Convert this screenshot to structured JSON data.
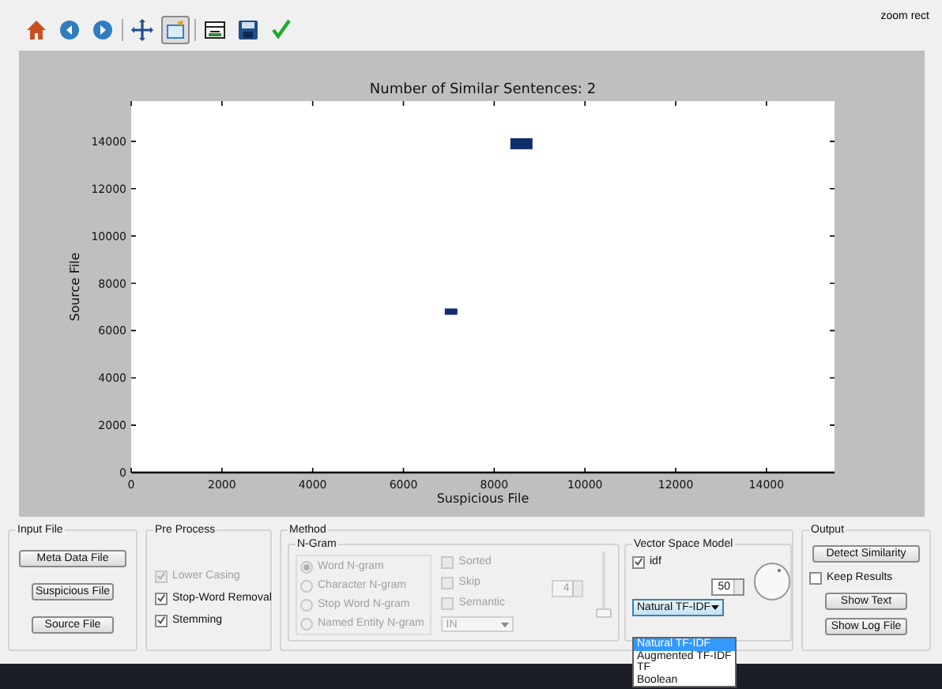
{
  "toolbar": {
    "tools": [
      {
        "kind": "home",
        "selected": false
      },
      {
        "kind": "back",
        "selected": false
      },
      {
        "kind": "forward",
        "selected": false
      },
      {
        "kind": "pan",
        "selected": false
      },
      {
        "kind": "zoom",
        "selected": true
      },
      {
        "kind": "subplots",
        "selected": false
      },
      {
        "kind": "save",
        "selected": false
      },
      {
        "kind": "check",
        "selected": false
      }
    ],
    "mode_label": "zoom rect"
  },
  "plot": {
    "chart_data": {
      "type": "scatter",
      "title": "Number of Similar Sentences: 2",
      "xlabel": "Suspicious File",
      "ylabel": "Source File",
      "x": [
        8600,
        7050
      ],
      "values": [
        13900,
        6800
      ],
      "xlim": [
        0,
        15500
      ],
      "ylim": [
        0,
        15700
      ],
      "xticks": [
        0,
        2000,
        4000,
        6000,
        8000,
        10000,
        12000,
        14000
      ],
      "yticks": [
        0,
        2000,
        4000,
        6000,
        8000,
        10000,
        12000,
        14000
      ]
    }
  },
  "input_file": {
    "title": "Input File",
    "buttons": [
      "Meta Data File",
      "Suspicious File",
      "Source File"
    ]
  },
  "pre_process": {
    "title": "Pre Process",
    "options": [
      {
        "label": "Lower Casing",
        "checked": true,
        "disabled": true
      },
      {
        "label": "Stop-Word Removal",
        "checked": true,
        "disabled": false
      },
      {
        "label": "Stemming",
        "checked": true,
        "disabled": false
      }
    ]
  },
  "method": {
    "title": "Method",
    "n_gram": {
      "title": "N-Gram",
      "radios": [
        {
          "label": "Word N-gram",
          "selected": true,
          "disabled": true
        },
        {
          "label": "Character N-gram",
          "selected": false,
          "disabled": true
        },
        {
          "label": "Stop Word N-gram",
          "selected": false,
          "disabled": true
        },
        {
          "label": "Named Entity N-gram",
          "selected": false,
          "disabled": true
        }
      ],
      "checkboxes": [
        {
          "label": "Sorted",
          "checked": false,
          "disabled": true
        },
        {
          "label": "Skip",
          "checked": false,
          "disabled": true
        },
        {
          "label": "Semantic",
          "checked": false,
          "disabled": true
        }
      ],
      "combo": {
        "value": "IN",
        "disabled": true
      },
      "spinbox": {
        "value": "4",
        "disabled": true
      },
      "slider": {
        "level": 0,
        "disabled": true
      }
    },
    "vector_space_model": {
      "title": "Vector Space Model",
      "idf": {
        "label": "idf",
        "checked": true
      },
      "spinbox": {
        "value": "50"
      },
      "combo": {
        "value": "Natural TF-IDF",
        "expanded": true,
        "options": [
          {
            "label": "Natural TF-IDF",
            "selected": true
          },
          {
            "label": "Augmented TF-IDF",
            "selected": false
          },
          {
            "label": "TF",
            "selected": false
          },
          {
            "label": "Boolean",
            "selected": false
          }
        ]
      }
    }
  },
  "output": {
    "title": "Output",
    "items": [
      {
        "kind": "button",
        "label": "Detect Similarity"
      },
      {
        "kind": "checkbox",
        "label": "Keep Results",
        "checked": false
      },
      {
        "kind": "button",
        "label": "Show Text"
      },
      {
        "kind": "button",
        "label": "Show Log File"
      }
    ]
  }
}
